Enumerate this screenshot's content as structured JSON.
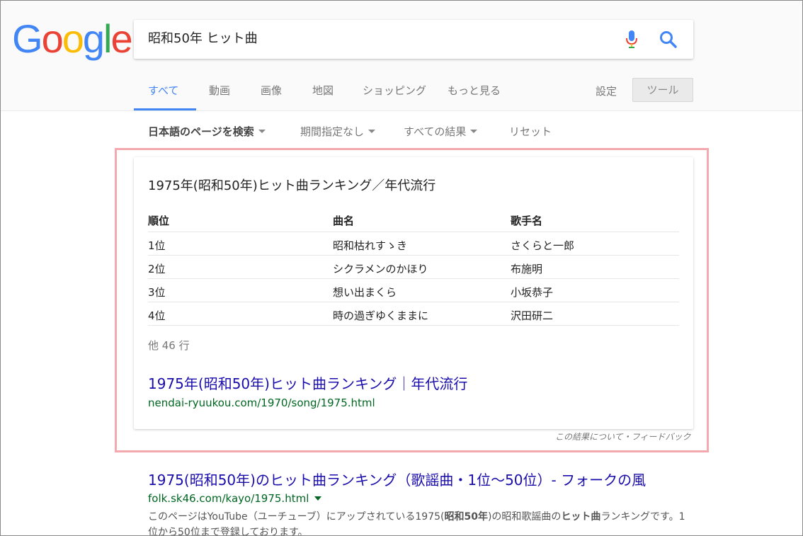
{
  "logo": {
    "letters": [
      "G",
      "o",
      "o",
      "g",
      "l",
      "e"
    ]
  },
  "search": {
    "query": "昭和50年 ヒット曲"
  },
  "tabs": [
    {
      "label": "すべて"
    },
    {
      "label": "動画"
    },
    {
      "label": "画像"
    },
    {
      "label": "地図"
    },
    {
      "label": "ショッピング"
    },
    {
      "label": "もっと見る"
    }
  ],
  "settings_label": "設定",
  "tools_label": "ツール",
  "filters": [
    {
      "label": "日本語のページを検索"
    },
    {
      "label": "期間指定なし"
    },
    {
      "label": "すべての結果"
    },
    {
      "label": "リセット"
    }
  ],
  "snippet": {
    "title": "1975年(昭和50年)ヒット曲ランキング／年代流行",
    "columns": [
      "順位",
      "曲名",
      "歌手名"
    ],
    "rows": [
      [
        "1位",
        "昭和枯れすゝき",
        "さくらと一郎"
      ],
      [
        "2位",
        "シクラメンのかほり",
        "布施明"
      ],
      [
        "3位",
        "想い出まくら",
        "小坂恭子"
      ],
      [
        "4位",
        "時の過ぎゆくままに",
        "沢田研二"
      ]
    ],
    "more_rows": "他 46 行",
    "link_title": "1975年(昭和50年)ヒット曲ランキング｜年代流行",
    "url": "nendai-ryuukou.com/1970/song/1975.html",
    "feedback": "この結果について・フィードバック"
  },
  "result2": {
    "title": "1975(昭和50年)のヒット曲ランキング（歌謡曲・1位〜50位）- フォークの風",
    "url": "folk.sk46.com/kayo/1975.html",
    "snippet_pre": "このページはYouTube（ユーチューブ）にアップされている1975(",
    "snippet_bold1": "昭和50年",
    "snippet_mid": ")の昭和歌謡曲の",
    "snippet_bold2": "ヒット曲",
    "snippet_post": "ランキングです。1位から50位まで登録しております。"
  },
  "colors": {
    "google_blue": "#4285f4",
    "link": "#1a0dab",
    "url_green": "#006621",
    "highlight": "#f4a9ae"
  },
  "icons": [
    "microphone-icon",
    "search-icon",
    "dropdown-caret-icon"
  ]
}
